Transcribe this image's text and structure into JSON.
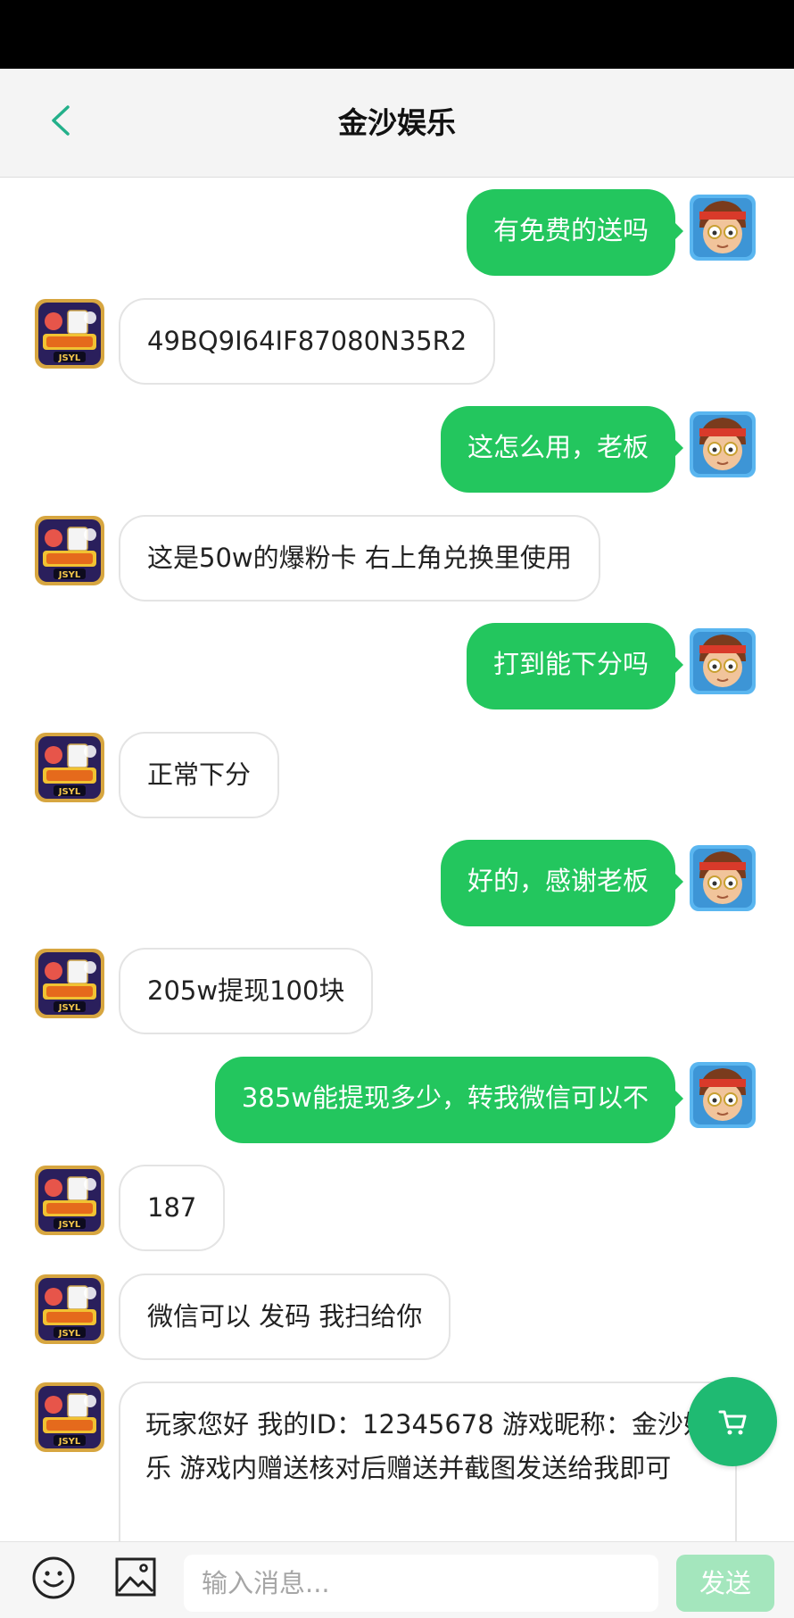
{
  "header": {
    "title": "金沙娱乐"
  },
  "messages": [
    {
      "side": "out",
      "text": "有免费的送吗"
    },
    {
      "side": "in",
      "text": "49BQ9I64IF87080N35R2"
    },
    {
      "side": "out",
      "text": "这怎么用，老板"
    },
    {
      "side": "in",
      "text": "这是50w的爆粉卡 右上角兑换里使用"
    },
    {
      "side": "out",
      "text": "打到能下分吗"
    },
    {
      "side": "in",
      "text": "正常下分"
    },
    {
      "side": "out",
      "text": "好的，感谢老板"
    },
    {
      "side": "in",
      "text": "205w提现100块"
    },
    {
      "side": "out",
      "text": "385w能提现多少，转我微信可以不"
    },
    {
      "side": "in",
      "text": "187"
    },
    {
      "side": "in",
      "text": "微信可以 发码 我扫给你"
    },
    {
      "side": "in",
      "text": "玩家您好 我的ID：12345678 游戏昵称：金沙娱乐 游戏内赠送核对后赠送并截图发送给我即可"
    }
  ],
  "shop_logo": {
    "text": "JSYL"
  },
  "input": {
    "placeholder": "输入消息..."
  },
  "send": {
    "label": "发送"
  },
  "colors": {
    "accent": "#23c65e",
    "send_disabled": "#a4e6bd",
    "fab": "#1fba72",
    "back": "#23b08a"
  },
  "icons": {
    "back": "chevron-left-icon",
    "emoji": "smiley-icon",
    "image": "image-icon",
    "cart": "cart-icon"
  }
}
